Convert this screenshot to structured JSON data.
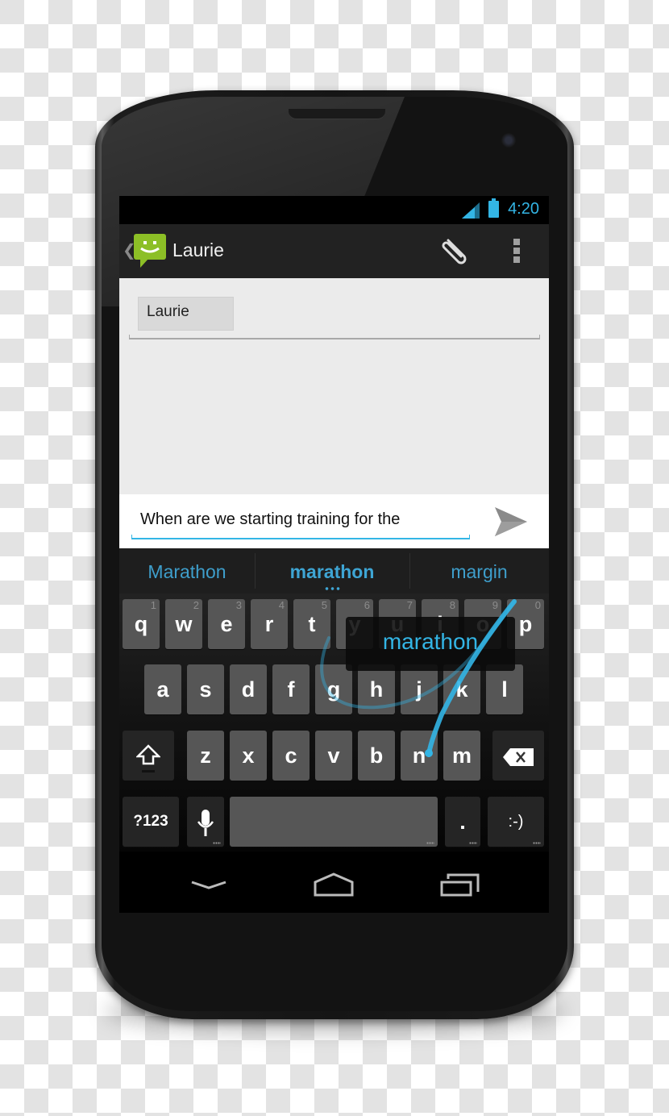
{
  "status_bar": {
    "time": "4:20",
    "signal_icon": "signal-icon",
    "battery_icon": "battery-icon"
  },
  "action_bar": {
    "back_icon": "back-caret-icon",
    "app_icon": "messaging-icon",
    "title": "Laurie",
    "attach_icon": "paperclip-icon",
    "overflow_icon": "overflow-menu-icon"
  },
  "compose": {
    "recipient_chip": "Laurie",
    "message_text": "When are we starting training for the",
    "send_icon": "send-icon"
  },
  "suggestions": {
    "items": [
      "Marathon",
      "marathon",
      "margin"
    ],
    "selected_index": 1,
    "more_indicator": "more-suggestions-icon"
  },
  "keyboard": {
    "row1": [
      {
        "key": "q",
        "hint": "1"
      },
      {
        "key": "w",
        "hint": "2"
      },
      {
        "key": "e",
        "hint": "3"
      },
      {
        "key": "r",
        "hint": "4"
      },
      {
        "key": "t",
        "hint": "5"
      },
      {
        "key": "y",
        "hint": "6"
      },
      {
        "key": "u",
        "hint": "7"
      },
      {
        "key": "i",
        "hint": "8"
      },
      {
        "key": "o",
        "hint": "9"
      },
      {
        "key": "p",
        "hint": "0"
      }
    ],
    "row2": [
      "a",
      "s",
      "d",
      "f",
      "g",
      "h",
      "j",
      "k",
      "l"
    ],
    "row3": [
      "z",
      "x",
      "c",
      "v",
      "b",
      "n",
      "m"
    ],
    "shift_icon": "shift-icon",
    "backspace_icon": "backspace-icon",
    "symbols_label": "?123",
    "mic_icon": "microphone-icon",
    "space_label": "",
    "period_label": ".",
    "smiley_label": ":-)",
    "gesture_preview": "marathon",
    "trail_color": "#33b5e5"
  },
  "nav_bar": {
    "back_icon": "nav-back-icon",
    "home_icon": "home-icon",
    "recents_icon": "recent-apps-icon"
  },
  "colors": {
    "accent": "#33b5e5",
    "action_bar": "#222222",
    "compose_bg": "#ebebeb",
    "key": "#565656"
  }
}
